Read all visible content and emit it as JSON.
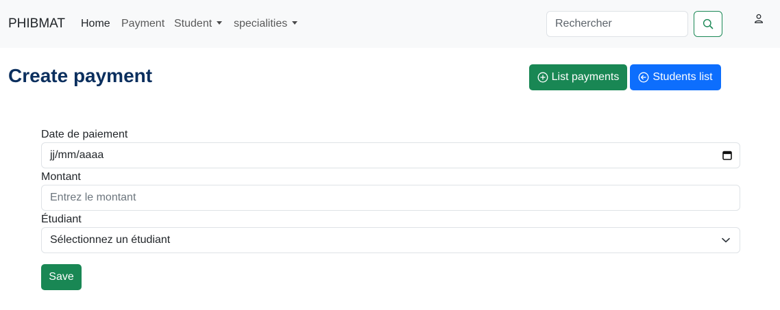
{
  "navbar": {
    "brand": "PHIBMAT",
    "links": [
      {
        "label": "Home",
        "active": true
      },
      {
        "label": "Payment"
      },
      {
        "label": "Student",
        "dropdown": true
      },
      {
        "label": "specialities",
        "dropdown": true
      }
    ],
    "search": {
      "placeholder": "Rechercher",
      "value": ""
    },
    "icons": {
      "search": "search-icon",
      "user": "person-icon"
    }
  },
  "page": {
    "title": "Create payment",
    "actions": {
      "list_payments": {
        "label": "List payments",
        "icon": "plus-circle-icon",
        "color": "#198754"
      },
      "students_list": {
        "label": "Students list",
        "icon": "arrow-left-circle-icon",
        "color": "#0d6efd"
      }
    }
  },
  "form": {
    "date": {
      "label": "Date de paiement",
      "value": "jj/mm/aaaa",
      "icon": "calendar-icon"
    },
    "amount": {
      "label": "Montant",
      "placeholder": "Entrez le montant",
      "value": ""
    },
    "student": {
      "label": "Étudiant",
      "selected": "Sélectionnez un étudiant",
      "icon": "chevron-down-icon"
    },
    "save_label": "Save"
  },
  "colors": {
    "navbar_bg": "#f8f9fa",
    "title": "#0b2f5e",
    "success": "#198754",
    "primary": "#0d6efd"
  }
}
